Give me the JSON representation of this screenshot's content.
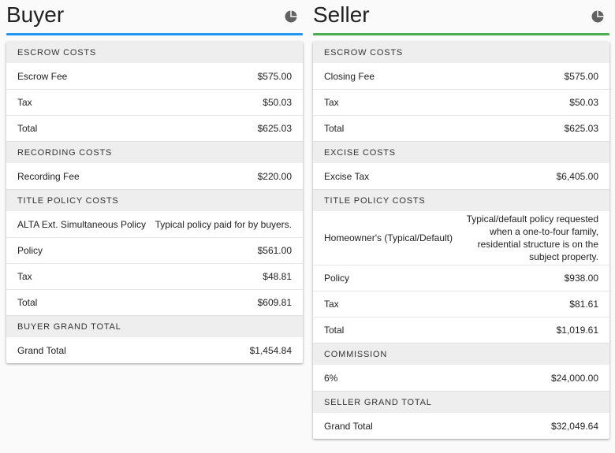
{
  "buyer": {
    "title": "Buyer",
    "accent": "#2196f3",
    "icon": "pie-chart-icon",
    "escrow": {
      "header": "Escrow Costs",
      "fee_label": "Escrow Fee",
      "fee_value": "$575.00",
      "tax_label": "Tax",
      "tax_value": "$50.03",
      "total_label": "Total",
      "total_value": "$625.03"
    },
    "recording": {
      "header": "Recording Costs",
      "fee_label": "Recording Fee",
      "fee_value": "$220.00"
    },
    "title_policy": {
      "header": "Title Policy Costs",
      "type_label": "ALTA Ext. Simultaneous Policy",
      "type_desc": "Typical policy paid for by buyers.",
      "policy_label": "Policy",
      "policy_value": "$561.00",
      "tax_label": "Tax",
      "tax_value": "$48.81",
      "total_label": "Total",
      "total_value": "$609.81"
    },
    "grand": {
      "header": "Buyer Grand Total",
      "label": "Grand Total",
      "value": "$1,454.84"
    }
  },
  "seller": {
    "title": "Seller",
    "accent": "#4caf50",
    "icon": "pie-chart-icon",
    "escrow": {
      "header": "Escrow Costs",
      "fee_label": "Closing Fee",
      "fee_value": "$575.00",
      "tax_label": "Tax",
      "tax_value": "$50.03",
      "total_label": "Total",
      "total_value": "$625.03"
    },
    "excise": {
      "header": "Excise Costs",
      "label": "Excise Tax",
      "value": "$6,405.00"
    },
    "title_policy": {
      "header": "Title Policy Costs",
      "type_label": "Homeowner's (Typical/Default)",
      "type_desc": "Typical/default policy requested when a one-to-four family, residential structure is on the subject property.",
      "policy_label": "Policy",
      "policy_value": "$938.00",
      "tax_label": "Tax",
      "tax_value": "$81.61",
      "total_label": "Total",
      "total_value": "$1,019.61"
    },
    "commission": {
      "header": "Commission",
      "label": "6%",
      "value": "$24,000.00"
    },
    "grand": {
      "header": "Seller Grand Total",
      "label": "Grand Total",
      "value": "$32,049.64"
    }
  }
}
